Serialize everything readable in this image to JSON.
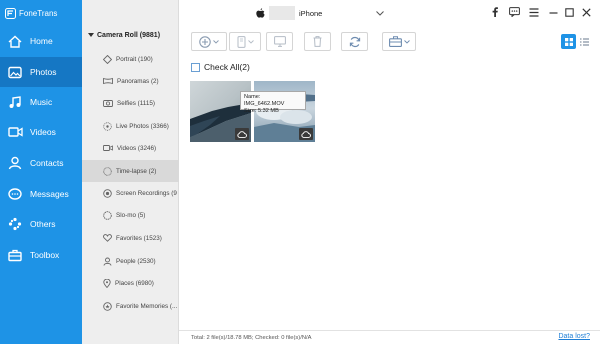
{
  "app": {
    "name": "FoneTrans",
    "device_name": "iPhone",
    "accent": "#1e93e6",
    "accent_active": "#1577c4"
  },
  "nav": [
    {
      "label": "Home",
      "icon": "home-icon"
    },
    {
      "label": "Photos",
      "icon": "photos-icon",
      "active": true
    },
    {
      "label": "Music",
      "icon": "music-icon"
    },
    {
      "label": "Videos",
      "icon": "videos-icon"
    },
    {
      "label": "Contacts",
      "icon": "contacts-icon"
    },
    {
      "label": "Messages",
      "icon": "messages-icon"
    },
    {
      "label": "Others",
      "icon": "others-icon"
    },
    {
      "label": "Toolbox",
      "icon": "toolbox-icon"
    }
  ],
  "albums": {
    "root": "Camera Roll (9881)",
    "items": [
      {
        "label": "Portrait (190)",
        "icon": "portrait-icon"
      },
      {
        "label": "Panoramas (2)",
        "icon": "panorama-icon"
      },
      {
        "label": "Selfies (1115)",
        "icon": "selfie-icon"
      },
      {
        "label": "Live Photos (3366)",
        "icon": "live-photo-icon"
      },
      {
        "label": "Videos (3246)",
        "icon": "video-icon"
      },
      {
        "label": "Time-lapse (2)",
        "icon": "timelapse-icon",
        "active": true
      },
      {
        "label": "Screen Recordings (9",
        "icon": "screen-recording-icon"
      },
      {
        "label": "Slo-mo (5)",
        "icon": "slomo-icon"
      },
      {
        "label": "Favorites (1523)",
        "icon": "heart-icon"
      },
      {
        "label": "People (2530)",
        "icon": "people-icon"
      },
      {
        "label": "Places (6980)",
        "icon": "places-icon"
      },
      {
        "label": "Favorite Memories (...",
        "icon": "memories-icon"
      }
    ]
  },
  "content": {
    "check_all": "Check All(2)",
    "tooltip": {
      "name": "Name: IMG_6462.MOV",
      "size": "Size: 5.32 MB"
    }
  },
  "status": {
    "summary": "Total: 2 file(s)/18.78 MB; Checked: 0 file(s)/N/A",
    "data_lost": "Data lost?"
  }
}
